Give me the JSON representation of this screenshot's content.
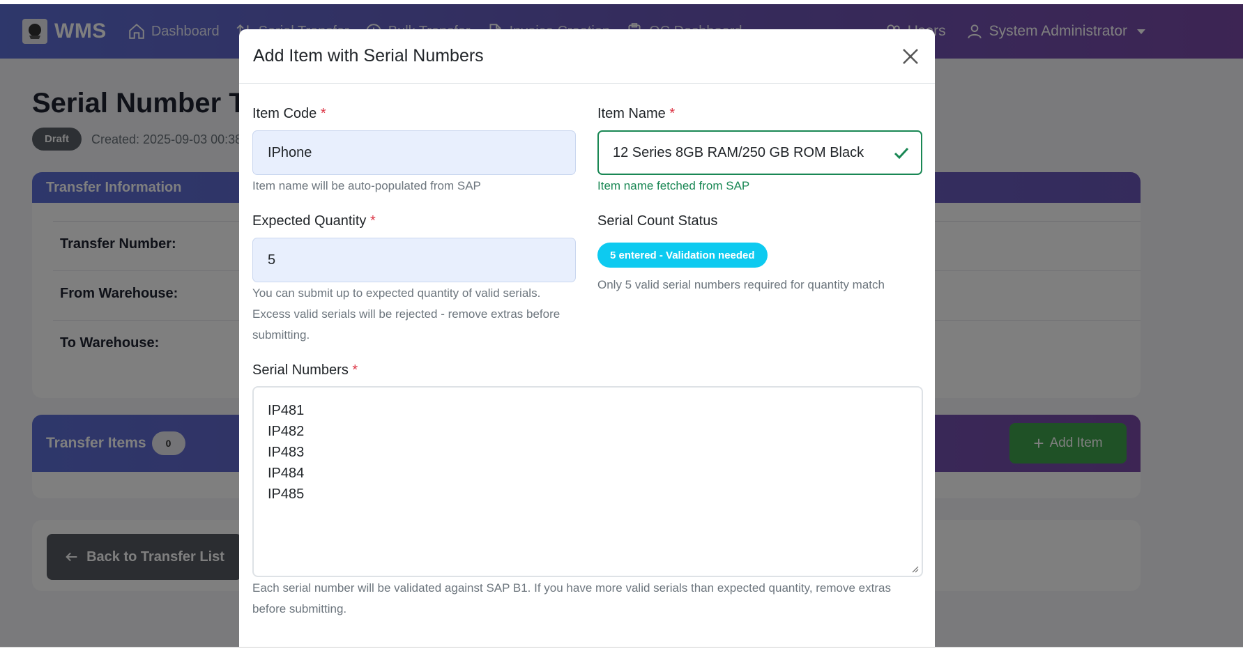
{
  "navbar": {
    "brand": "WMS",
    "items": [
      "Dashboard",
      "Serial Transfer",
      "Bulk Transfer",
      "Invoice Creation",
      "QC Dashboard"
    ],
    "users_label": "Users",
    "user_name": "System Administrator"
  },
  "page": {
    "title": "Serial Number Transfer",
    "status_badge": "Draft",
    "created": "Created: 2025-09-03 00:38"
  },
  "transfer_info": {
    "header": "Transfer Information",
    "rows": [
      "Transfer Number:",
      "From Warehouse:",
      "To Warehouse:"
    ]
  },
  "transfer_items": {
    "header": "Transfer Items",
    "count": "0",
    "add_button": "Add Item"
  },
  "back_button": "Back to Transfer List",
  "modal": {
    "title": "Add Item with Serial Numbers",
    "item_code": {
      "label": "Item Code",
      "required": "*",
      "value": "IPhone",
      "help": "Item name will be auto-populated from SAP"
    },
    "item_name": {
      "label": "Item Name",
      "required": "*",
      "value": "12 Series 8GB RAM/250 GB ROM Black",
      "feedback": "Item name fetched from SAP"
    },
    "expected_quantity": {
      "label": "Expected Quantity",
      "required": "*",
      "value": "5",
      "help_line1": "You can submit up to expected quantity of valid serials.",
      "help_line2": "Excess valid serials will be rejected - remove extras before",
      "help_line3": "submitting."
    },
    "serial_count_status": {
      "label": "Serial Count Status",
      "badge": "5 entered - Validation needed",
      "help": "Only 5 valid serial numbers required for quantity match"
    },
    "serial_numbers": {
      "label": "Serial Numbers",
      "required": "*",
      "values": [
        "IP481",
        "IP482",
        "IP483",
        "IP484",
        "IP485"
      ],
      "help_line1": "Each serial number will be validated against SAP B1. If you have more valid serials than expected quantity, remove extras",
      "help_line2": "before submitting."
    }
  },
  "colors": {
    "navbar_start": "#5d6fd6",
    "navbar_end": "#7a4aa8",
    "valid_green": "#198754",
    "info_badge": "#0dcaf0",
    "required_red": "#dc3545"
  }
}
